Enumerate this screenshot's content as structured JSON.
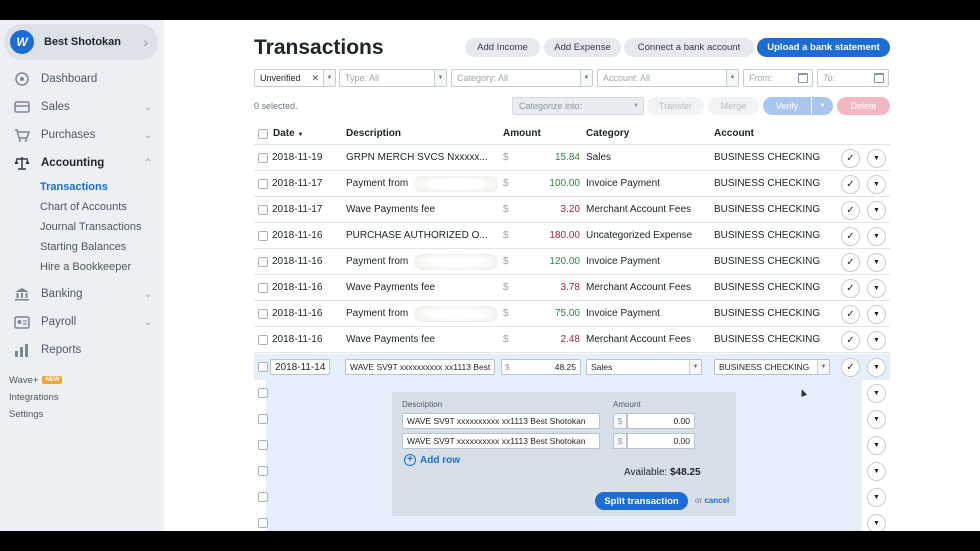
{
  "sidebar": {
    "business_name": "Best Shotokan",
    "logo_glyph": "W",
    "nav": [
      {
        "label": "Dashboard",
        "icon": "dashboard-icon",
        "has_chevron": false
      },
      {
        "label": "Sales",
        "icon": "sales-icon",
        "has_chevron": true
      },
      {
        "label": "Purchases",
        "icon": "cart-icon",
        "has_chevron": true
      },
      {
        "label": "Accounting",
        "icon": "scale-icon",
        "has_chevron": true,
        "expanded": true
      },
      {
        "label": "Banking",
        "icon": "bank-icon",
        "has_chevron": true
      },
      {
        "label": "Payroll",
        "icon": "payroll-icon",
        "has_chevron": true
      },
      {
        "label": "Reports",
        "icon": "reports-icon",
        "has_chevron": false
      }
    ],
    "accounting_sub": [
      "Transactions",
      "Chart of Accounts",
      "Journal Transactions",
      "Starting Balances",
      "Hire a Bookkeeper"
    ],
    "footer": {
      "wave_plus": "Wave+",
      "new_badge": "NEW",
      "integrations": "Integrations",
      "settings": "Settings"
    }
  },
  "header": {
    "title": "Transactions",
    "buttons": {
      "add_income": "Add Income",
      "add_expense": "Add Expense",
      "connect_bank": "Connect a bank account",
      "upload_statement": "Upload a bank statement"
    }
  },
  "filters": {
    "status": "Unverified",
    "type_placeholder": "Type: All",
    "category_placeholder": "Category: All",
    "account_placeholder": "Account: All",
    "from_placeholder": "From:",
    "to_placeholder": "To:"
  },
  "actions": {
    "selected": "0 selected.",
    "categorize_into": "Categorize into:",
    "transfer": "Transfer",
    "merge": "Merge",
    "verify": "Verify",
    "delete": "Delete"
  },
  "table": {
    "headers": {
      "date": "Date",
      "description": "Description",
      "amount": "Amount",
      "category": "Category",
      "account": "Account"
    },
    "currency": "$",
    "rows": [
      {
        "date": "2018-11-19",
        "description": "GRPN MERCH SVCS Nxxxxx...",
        "amount": "15.84",
        "sign": "pos",
        "category": "Sales",
        "account": "BUSINESS CHECKING",
        "blur": false
      },
      {
        "date": "2018-11-17",
        "description": "Payment from",
        "amount": "100.00",
        "sign": "pos",
        "category": "Invoice Payment",
        "account": "BUSINESS CHECKING",
        "blur": true
      },
      {
        "date": "2018-11-17",
        "description": "Wave Payments fee",
        "amount": "3.20",
        "sign": "neg",
        "category": "Merchant Account Fees",
        "account": "BUSINESS CHECKING",
        "blur": false
      },
      {
        "date": "2018-11-16",
        "description": "PURCHASE AUTHORIZED O...",
        "amount": "180.00",
        "sign": "neg",
        "category": "Uncategorized Expense",
        "account": "BUSINESS CHECKING",
        "blur": false
      },
      {
        "date": "2018-11-16",
        "description": "Payment from",
        "amount": "120.00",
        "sign": "pos",
        "category": "Invoice Payment",
        "account": "BUSINESS CHECKING",
        "blur": true
      },
      {
        "date": "2018-11-16",
        "description": "Wave Payments fee",
        "amount": "3.78",
        "sign": "neg",
        "category": "Merchant Account Fees",
        "account": "BUSINESS CHECKING",
        "blur": false
      },
      {
        "date": "2018-11-16",
        "description": "Payment from",
        "amount": "75.00",
        "sign": "pos",
        "category": "Invoice Payment",
        "account": "BUSINESS CHECKING",
        "blur": true
      },
      {
        "date": "2018-11-16",
        "description": "Wave Payments fee",
        "amount": "2.48",
        "sign": "neg",
        "category": "Merchant Account Fees",
        "account": "BUSINESS CHECKING",
        "blur": false
      }
    ],
    "editing": {
      "date": "2018-11-14",
      "description": "WAVE SV9T xxxxxxxxxx xx1113 Best",
      "amount": "48.25",
      "category": "Sales",
      "account": "BUSINESS CHECKING"
    }
  },
  "split": {
    "description_label": "Description",
    "amount_label": "Amount",
    "lines": [
      {
        "description": "WAVE SV9T xxxxxxxxxx xx1113 Best Shotokan",
        "amount": "0.00"
      },
      {
        "description": "WAVE SV9T xxxxxxxxxx xx1113 Best Shotokan",
        "amount": "0.00"
      }
    ],
    "add_row": "Add row",
    "available_label": "Available:",
    "available_value": "$48.25",
    "split_button": "Split transaction",
    "or": "or",
    "cancel": "cancel"
  }
}
